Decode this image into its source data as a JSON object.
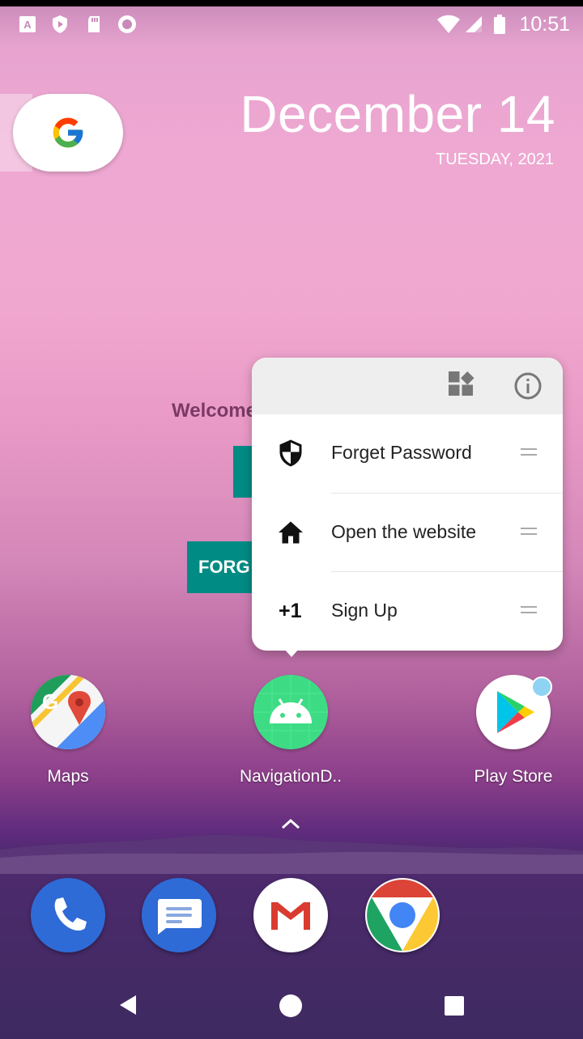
{
  "status_bar": {
    "time": "10:51",
    "icons": [
      "autofill-icon",
      "shield-icon",
      "sd-card-icon",
      "record-icon",
      "wifi-icon",
      "signal-icon",
      "battery-icon"
    ]
  },
  "widget": {
    "date": "December 14",
    "weekday": "TUESDAY, 2021"
  },
  "background_app": {
    "welcome_text": "Welcome",
    "button_text": "FORG"
  },
  "popup": {
    "header_icons": [
      "widgets-icon",
      "info-icon"
    ],
    "shortcuts": [
      {
        "label": "Forget Password",
        "icon": "shield-icon"
      },
      {
        "label": "Open the website",
        "icon": "home-icon"
      },
      {
        "label": "Sign Up",
        "icon": "plus-one-icon",
        "glyph": "+1"
      }
    ]
  },
  "home_apps": [
    {
      "name": "Maps"
    },
    {
      "name": "NavigationD.."
    },
    {
      "name": "Play Store"
    }
  ],
  "dock": [
    "phone-icon",
    "messages-icon",
    "gmail-icon",
    "chrome-icon"
  ],
  "colors": {
    "teal": "#008b84",
    "popup_header": "#eeeeee"
  }
}
